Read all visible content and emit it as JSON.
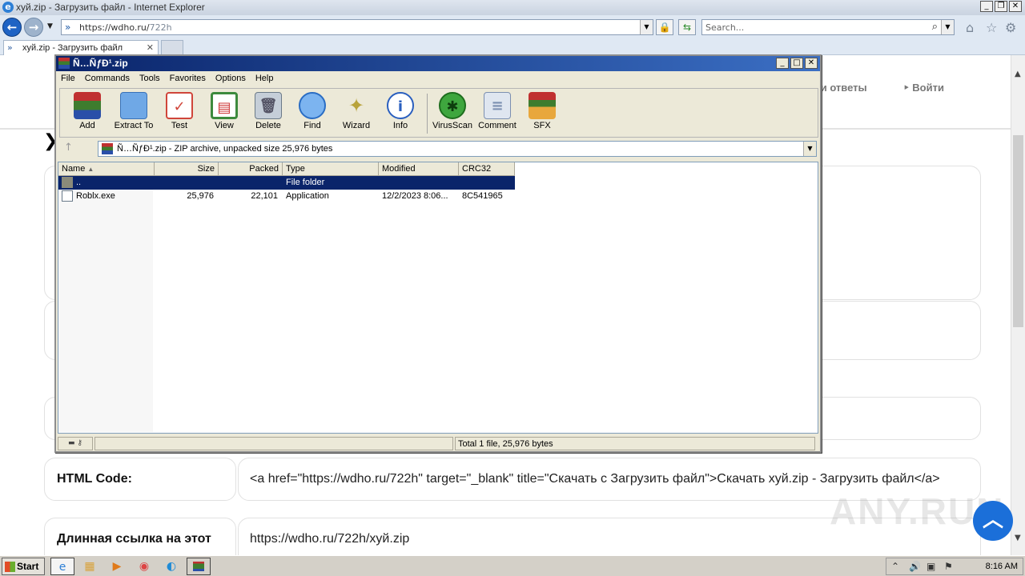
{
  "browser": {
    "title": "хуй.zip - Загрузить файл - Internet Explorer",
    "address_prefix": "https://wdho.ru/",
    "address_path": "722h",
    "search_placeholder": "Search...",
    "tab_label": "хуй.zip - Загрузить файл"
  },
  "site": {
    "nav_item": "ы и ответы",
    "login": "Войти",
    "html_code_label": "HTML Code",
    "html_code_value": "<a href=\"https://wdho.ru/722h\" target=\"_blank\" title=\"Скачать с Загрузить файл\">Скачать хуй.zip - Загрузить файл</a>",
    "long_link_label": "Длинная ссылка на этот",
    "long_link_value": "https://wdho.ru/722h/хуй.zip",
    "watermark": "ANY.RUN"
  },
  "winrar": {
    "title": "Ñ…ÑƒÐ¹.zip",
    "menu": [
      "File",
      "Commands",
      "Tools",
      "Favorites",
      "Options",
      "Help"
    ],
    "tools": [
      {
        "label": "Add",
        "icon": "add-icon",
        "color": "#c0392b"
      },
      {
        "label": "Extract To",
        "icon": "extract-icon",
        "color": "#4a90d9"
      },
      {
        "label": "Test",
        "icon": "test-icon",
        "color": "#d0453a"
      },
      {
        "label": "View",
        "icon": "view-icon",
        "color": "#3d8a3d"
      },
      {
        "label": "Delete",
        "icon": "delete-icon",
        "color": "#8a9aa8"
      },
      {
        "label": "Find",
        "icon": "find-icon",
        "color": "#2a6dc4"
      },
      {
        "label": "Wizard",
        "icon": "wizard-icon",
        "color": "#b8a33a"
      },
      {
        "label": "Info",
        "icon": "info-icon",
        "color": "#2a5fbf"
      },
      {
        "label": "VirusScan",
        "icon": "virusscan-icon",
        "color": "#2e9a2e"
      },
      {
        "label": "Comment",
        "icon": "comment-icon",
        "color": "#7b8fb0"
      },
      {
        "label": "SFX",
        "icon": "sfx-icon",
        "color": "#c97a2a"
      }
    ],
    "path": "Ñ…ÑƒÐ¹.zip - ZIP archive, unpacked size 25,976 bytes",
    "columns": [
      "Name",
      "Size",
      "Packed",
      "Type",
      "Modified",
      "CRC32"
    ],
    "rows": [
      {
        "name": "..",
        "size": "",
        "packed": "",
        "type": "File folder",
        "modified": "",
        "crc": ""
      },
      {
        "name": "Roblx.exe",
        "size": "25,976",
        "packed": "22,101",
        "type": "Application",
        "modified": "12/2/2023 8:06...",
        "crc": "8C541965"
      }
    ],
    "status": "Total 1 file, 25,976 bytes"
  },
  "taskbar": {
    "start": "Start",
    "clock": "8:16 AM"
  }
}
